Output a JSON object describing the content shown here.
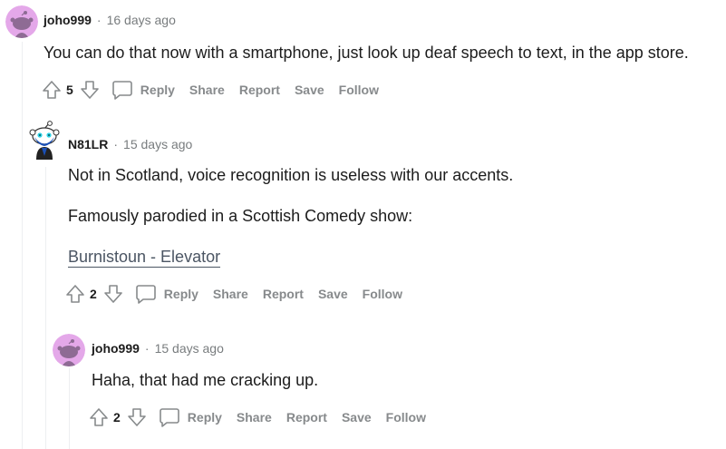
{
  "comments": [
    {
      "username": "joho999",
      "time": "16 days ago",
      "body": [
        "You can do that now with a smartphone, just look up deaf speech to text, in the app store."
      ],
      "score": "5"
    },
    {
      "username": "N81LR",
      "time": "15 days ago",
      "body": [
        "Not in Scotland, voice recognition is useless with our accents.",
        "Famously parodied in a Scottish Comedy show:"
      ],
      "link": "Burnistoun - Elevator",
      "score": "2"
    },
    {
      "username": "joho999",
      "time": "15 days ago",
      "body": [
        "Haha, that had me cracking up."
      ],
      "score": "2"
    }
  ],
  "actions": {
    "reply": "Reply",
    "share": "Share",
    "report": "Report",
    "save": "Save",
    "follow": "Follow"
  },
  "separator": "·",
  "colors": {
    "meta": "#787c7e",
    "action": "#878a8c",
    "avatar_pink": "#e4a8e9",
    "avatar_snoo": "#8e6b94"
  }
}
